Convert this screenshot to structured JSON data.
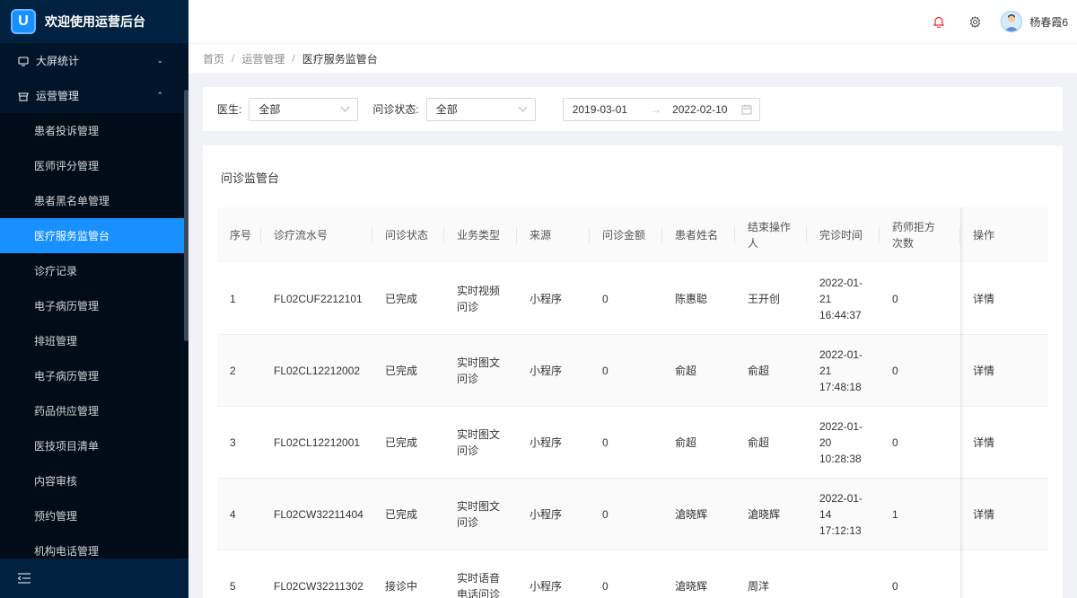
{
  "app": {
    "title": "欢迎使用运营后台",
    "logo_glyph": "U"
  },
  "sidebar": {
    "groups": [
      {
        "label": "大屏统计",
        "expanded": false
      },
      {
        "label": "运营管理",
        "expanded": true
      }
    ],
    "items": [
      {
        "label": "患者投诉管理"
      },
      {
        "label": "医师评分管理"
      },
      {
        "label": "患者黑名单管理"
      },
      {
        "label": "医疗服务监管台",
        "active": true
      },
      {
        "label": "诊疗记录"
      },
      {
        "label": "电子病历管理"
      },
      {
        "label": "排班管理"
      },
      {
        "label": "电子病历管理"
      },
      {
        "label": "药品供应管理"
      },
      {
        "label": "医技项目清单"
      },
      {
        "label": "内容审核"
      },
      {
        "label": "预约管理"
      },
      {
        "label": "机构电话管理"
      }
    ]
  },
  "header": {
    "username": "杨春霞6",
    "bell_color": "#f5222d"
  },
  "breadcrumb": {
    "items": [
      "首页",
      "运营管理",
      "医疗服务监管台"
    ]
  },
  "filters": {
    "doctor_label": "医生:",
    "doctor_value": "全部",
    "status_label": "问诊状态:",
    "status_value": "全部",
    "date_start": "2019-03-01",
    "date_end": "2022-02-10",
    "range_sep": "→"
  },
  "card": {
    "title": "问诊监管台"
  },
  "table": {
    "headers": [
      "序号",
      "诊疗流水号",
      "问诊状态",
      "业务类型",
      "来源",
      "问诊金额",
      "患者姓名",
      "结束操作人",
      "完诊时间",
      "药师拒方次数",
      "操作"
    ],
    "rows": [
      {
        "no": "1",
        "serial": "FL02CUF2212101",
        "status": "已完成",
        "type": "实时视频问诊",
        "source": "小程序",
        "amount": "0",
        "patient": "陈惠聪",
        "operator": "王开创",
        "time": "2022-01-21 16:44:37",
        "rejects": "0",
        "action": "详情"
      },
      {
        "no": "2",
        "serial": "FL02CL12212002",
        "status": "已完成",
        "type": "实时图文问诊",
        "source": "小程序",
        "amount": "0",
        "patient": "俞超",
        "operator": "俞超",
        "time": "2022-01-21 17:48:18",
        "rejects": "0",
        "action": "详情"
      },
      {
        "no": "3",
        "serial": "FL02CL12212001",
        "status": "已完成",
        "type": "实时图文问诊",
        "source": "小程序",
        "amount": "0",
        "patient": "俞超",
        "operator": "俞超",
        "time": "2022-01-20 10:28:38",
        "rejects": "0",
        "action": "详情"
      },
      {
        "no": "4",
        "serial": "FL02CW32211404",
        "status": "已完成",
        "type": "实时图文问诊",
        "source": "小程序",
        "amount": "0",
        "patient": "滄晓辉",
        "operator": "滄晓辉",
        "time": "2022-01-14 17:12:13",
        "rejects": "1",
        "action": "详情"
      },
      {
        "no": "5",
        "serial": "FL02CW32211302",
        "status": "接诊中",
        "type": "实时语音电话问诊",
        "source": "小程序",
        "amount": "0",
        "patient": "滄晓辉",
        "operator": "周洋",
        "time": "",
        "rejects": "0",
        "action": ""
      }
    ]
  },
  "colors": {
    "sidebar_bg": "#001529",
    "accent": "#1890ff"
  }
}
